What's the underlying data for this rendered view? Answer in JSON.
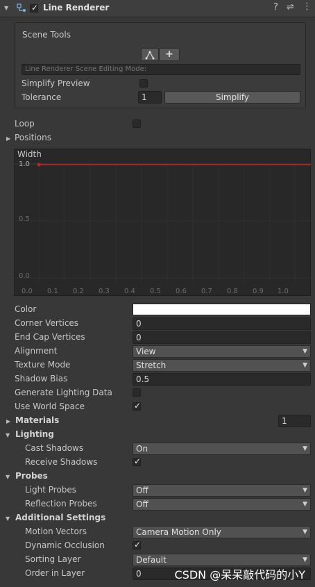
{
  "header": {
    "title": "Line Renderer",
    "enabled": true
  },
  "scene_tools": {
    "title": "Scene Tools",
    "mode_label": "Line Renderer Scene Editing Mode:",
    "simplify_preview_label": "Simplify Preview",
    "tolerance_label": "Tolerance",
    "tolerance_value": "1",
    "simplify_button": "Simplify",
    "add_button": "+"
  },
  "loop": {
    "label": "Loop"
  },
  "positions": {
    "label": "Positions"
  },
  "width_curve": {
    "label": "Width",
    "y_ticks": [
      "1.0",
      "0.5",
      "0.0"
    ],
    "x_ticks": [
      "0.0",
      "0.1",
      "0.2",
      "0.3",
      "0.4",
      "0.5",
      "0.6",
      "0.7",
      "0.8",
      "0.9",
      "1.0"
    ],
    "curve_color": "#c82020"
  },
  "properties": {
    "color_label": "Color",
    "color_value": "#ffffff",
    "corner_vertices_label": "Corner Vertices",
    "corner_vertices_value": "0",
    "end_cap_vertices_label": "End Cap Vertices",
    "end_cap_vertices_value": "0",
    "alignment_label": "Alignment",
    "alignment_value": "View",
    "texture_mode_label": "Texture Mode",
    "texture_mode_value": "Stretch",
    "shadow_bias_label": "Shadow Bias",
    "shadow_bias_value": "0.5",
    "generate_lighting_label": "Generate Lighting Data",
    "use_world_space_label": "Use World Space"
  },
  "materials": {
    "label": "Materials",
    "count": "1"
  },
  "lighting": {
    "label": "Lighting",
    "cast_shadows_label": "Cast Shadows",
    "cast_shadows_value": "On",
    "receive_shadows_label": "Receive Shadows"
  },
  "probes": {
    "label": "Probes",
    "light_probes_label": "Light Probes",
    "light_probes_value": "Off",
    "reflection_probes_label": "Reflection Probes",
    "reflection_probes_value": "Off"
  },
  "additional": {
    "label": "Additional Settings",
    "motion_vectors_label": "Motion Vectors",
    "motion_vectors_value": "Camera Motion Only",
    "dynamic_occlusion_label": "Dynamic Occlusion",
    "sorting_layer_label": "Sorting Layer",
    "sorting_layer_value": "Default",
    "order_in_layer_label": "Order in Layer",
    "order_in_layer_value": "0"
  },
  "watermark": "CSDN @呆呆敲代码的小Y"
}
